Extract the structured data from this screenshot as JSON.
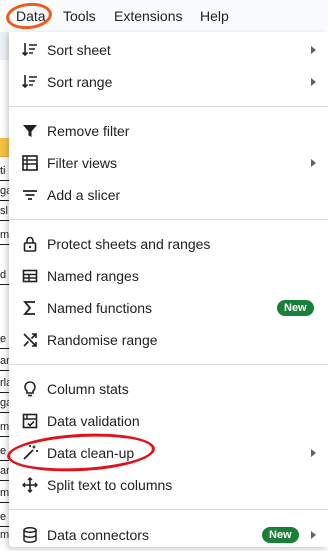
{
  "menubar": {
    "items": [
      "Data",
      "Tools",
      "Extensions",
      "Help"
    ]
  },
  "sheet_fragments": [
    "ti",
    "ga",
    "sl",
    "m",
    "d",
    "e",
    "ar",
    "rla",
    "ga",
    "m",
    "e",
    "ar",
    "m",
    "e",
    "m"
  ],
  "menu": {
    "sort_sheet": "Sort sheet",
    "sort_range": "Sort range",
    "remove_filter": "Remove filter",
    "filter_views": "Filter views",
    "add_slicer": "Add a slicer",
    "protect": "Protect sheets and ranges",
    "named_ranges": "Named ranges",
    "named_functions": "Named functions",
    "named_functions_badge": "New",
    "randomise": "Randomise range",
    "column_stats": "Column stats",
    "data_validation": "Data validation",
    "data_cleanup": "Data clean-up",
    "split_text": "Split text to columns",
    "data_connectors": "Data connectors",
    "data_connectors_badge": "New"
  },
  "colors": {
    "badge": "#188038",
    "annotation_orange": "#f05a1c",
    "annotation_red": "#e0131b",
    "highlight_cell": "#f6c142"
  },
  "icons": {
    "sort_sheet": "sort-icon",
    "sort_range": "sort-icon",
    "remove_filter": "filter-icon",
    "filter_views": "filter-views-icon",
    "add_slicer": "slicer-icon",
    "protect": "lock-icon",
    "named_ranges": "table-icon",
    "named_functions": "sigma-icon",
    "randomise": "shuffle-icon",
    "column_stats": "lightbulb-icon",
    "data_validation": "checklist-icon",
    "data_cleanup": "magic-wand-icon",
    "split_text": "split-columns-icon",
    "data_connectors": "database-icon"
  }
}
